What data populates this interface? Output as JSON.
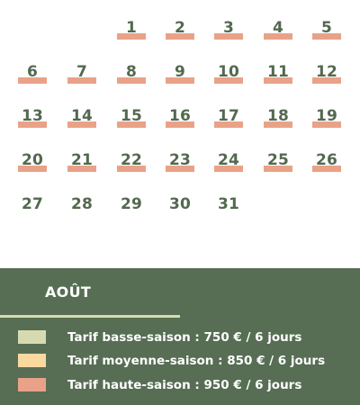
{
  "calendar": {
    "days": [
      "1",
      "2",
      "3",
      "4",
      "5",
      "6",
      "7",
      "8",
      "9",
      "10",
      "11",
      "12",
      "13",
      "14",
      "15",
      "16",
      "17",
      "18",
      "19",
      "20",
      "21",
      "22",
      "23",
      "24",
      "25",
      "26",
      "27",
      "28",
      "29",
      "30",
      "31"
    ],
    "marked_days": [
      "1",
      "2",
      "3",
      "4",
      "5",
      "6",
      "7",
      "8",
      "9",
      "10",
      "11",
      "12",
      "13",
      "14",
      "15",
      "16",
      "17",
      "18",
      "19",
      "20",
      "21",
      "22",
      "23",
      "24",
      "25",
      "26"
    ],
    "high_season_color": "#e9a287",
    "number_color": "#53694f"
  },
  "panel": {
    "month": "AOÛT",
    "background_color": "#576e54",
    "underline_color": "#d9dcb0",
    "legend": [
      {
        "label": "Tarif basse-saison : 750 € / 6 jours",
        "color": "#d7dab0"
      },
      {
        "label": "Tarif moyenne-saison : 850 € / 6 jours",
        "color": "#fbd8a0"
      },
      {
        "label": "Tarif haute-saison : 950 € / 6 jours",
        "color": "#e9a287"
      }
    ]
  }
}
